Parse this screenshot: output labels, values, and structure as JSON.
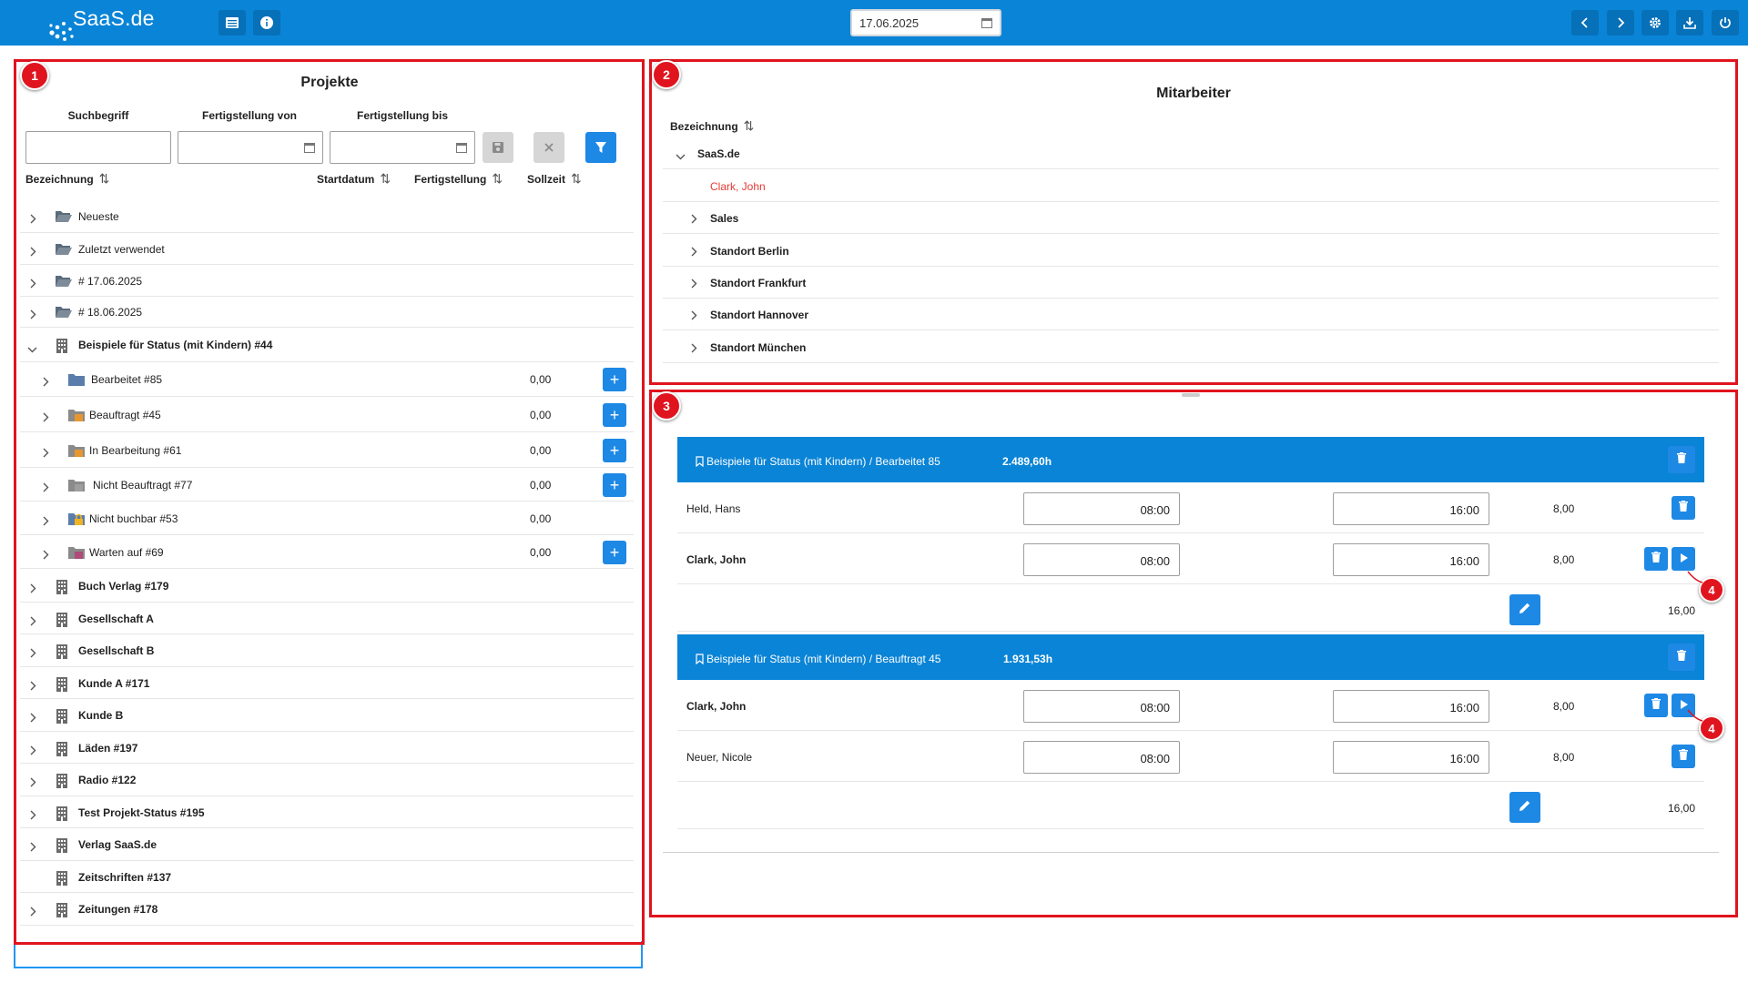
{
  "app": {
    "logo_text": "SaaS.de"
  },
  "toolbar": {
    "date_value": "17.06.2025"
  },
  "markers": [
    "1",
    "2",
    "3",
    "4",
    "4"
  ],
  "projects": {
    "title": "Projekte",
    "filters": {
      "search_label": "Suchbegriff",
      "from_label": "Fertigstellung von",
      "to_label": "Fertigstellung bis"
    },
    "columns": {
      "name": "Bezeichnung",
      "start": "Startdatum",
      "finish": "Fertigstellung",
      "target": "Sollzeit"
    },
    "rows": [
      {
        "label": "Neueste",
        "icon": "folder-open-icon"
      },
      {
        "label": "Zuletzt verwendet",
        "icon": "folder-open-icon"
      },
      {
        "label": "# 17.06.2025",
        "icon": "folder-open-icon"
      },
      {
        "label": "# 18.06.2025",
        "icon": "folder-open-icon"
      },
      {
        "label": "Beispiele für Status (mit Kindern) #44",
        "icon": "building-icon",
        "expanded": true
      },
      {
        "label": "Bearbeitet #85",
        "icon": "status-folder-icon",
        "value": "0,00"
      },
      {
        "label": "Beauftragt #45",
        "icon": "status-folder-icon",
        "value": "0,00"
      },
      {
        "label": "In Bearbeitung #61",
        "icon": "status-folder-icon",
        "value": "0,00"
      },
      {
        "label": "Nicht Beauftragt #77",
        "icon": "status-folder-icon",
        "value": "0,00"
      },
      {
        "label": "Nicht buchbar #53",
        "icon": "lock-folder-icon",
        "value": "0,00"
      },
      {
        "label": "Warten auf #69",
        "icon": "status-folder-icon",
        "value": "0,00"
      },
      {
        "label": "Buch Verlag #179",
        "icon": "building-icon"
      },
      {
        "label": "Gesellschaft A",
        "icon": "building-icon"
      },
      {
        "label": "Gesellschaft B",
        "icon": "building-icon"
      },
      {
        "label": "Kunde A #171",
        "icon": "building-icon"
      },
      {
        "label": "Kunde B",
        "icon": "building-icon"
      },
      {
        "label": "Läden #197",
        "icon": "building-icon"
      },
      {
        "label": "Radio #122",
        "icon": "building-icon"
      },
      {
        "label": "Test Projekt-Status #195",
        "icon": "building-icon"
      },
      {
        "label": "Verlag SaaS.de",
        "icon": "building-icon"
      },
      {
        "label": "Zeitschriften #137",
        "icon": "building-icon"
      },
      {
        "label": "Zeitungen #178",
        "icon": "building-icon"
      }
    ]
  },
  "employees": {
    "title": "Mitarbeiter",
    "column": "Bezeichnung",
    "rows": [
      {
        "label": "SaaS.de"
      },
      {
        "label": "Clark, John"
      },
      {
        "label": "Sales"
      },
      {
        "label": "Standort Berlin"
      },
      {
        "label": "Standort Frankfurt"
      },
      {
        "label": "Standort Hannover"
      },
      {
        "label": "Standort München"
      }
    ]
  },
  "bookings": {
    "groups": [
      {
        "title": "Beispiele für Status (mit Kindern) / Bearbeitet 85",
        "hours": "2.489,60h",
        "entries": [
          {
            "name": "Held, Hans",
            "start": "08:00",
            "end": "16:00",
            "sum": "8,00"
          },
          {
            "name": "Clark, John",
            "start": "08:00",
            "end": "16:00",
            "sum": "8,00"
          }
        ],
        "total": "16,00"
      },
      {
        "title": "Beispiele für Status (mit Kindern) / Beauftragt 45",
        "hours": "1.931,53h",
        "entries": [
          {
            "name": "Clark, John",
            "start": "08:00",
            "end": "16:00",
            "sum": "8,00"
          },
          {
            "name": "Neuer, Nicole",
            "start": "08:00",
            "end": "16:00",
            "sum": "8,00"
          }
        ],
        "total": "16,00"
      }
    ]
  },
  "colors": {
    "primary": "#0a84d6",
    "button": "#1e88e5",
    "highlight": "#e0141e",
    "employee_active": "#e53935"
  }
}
